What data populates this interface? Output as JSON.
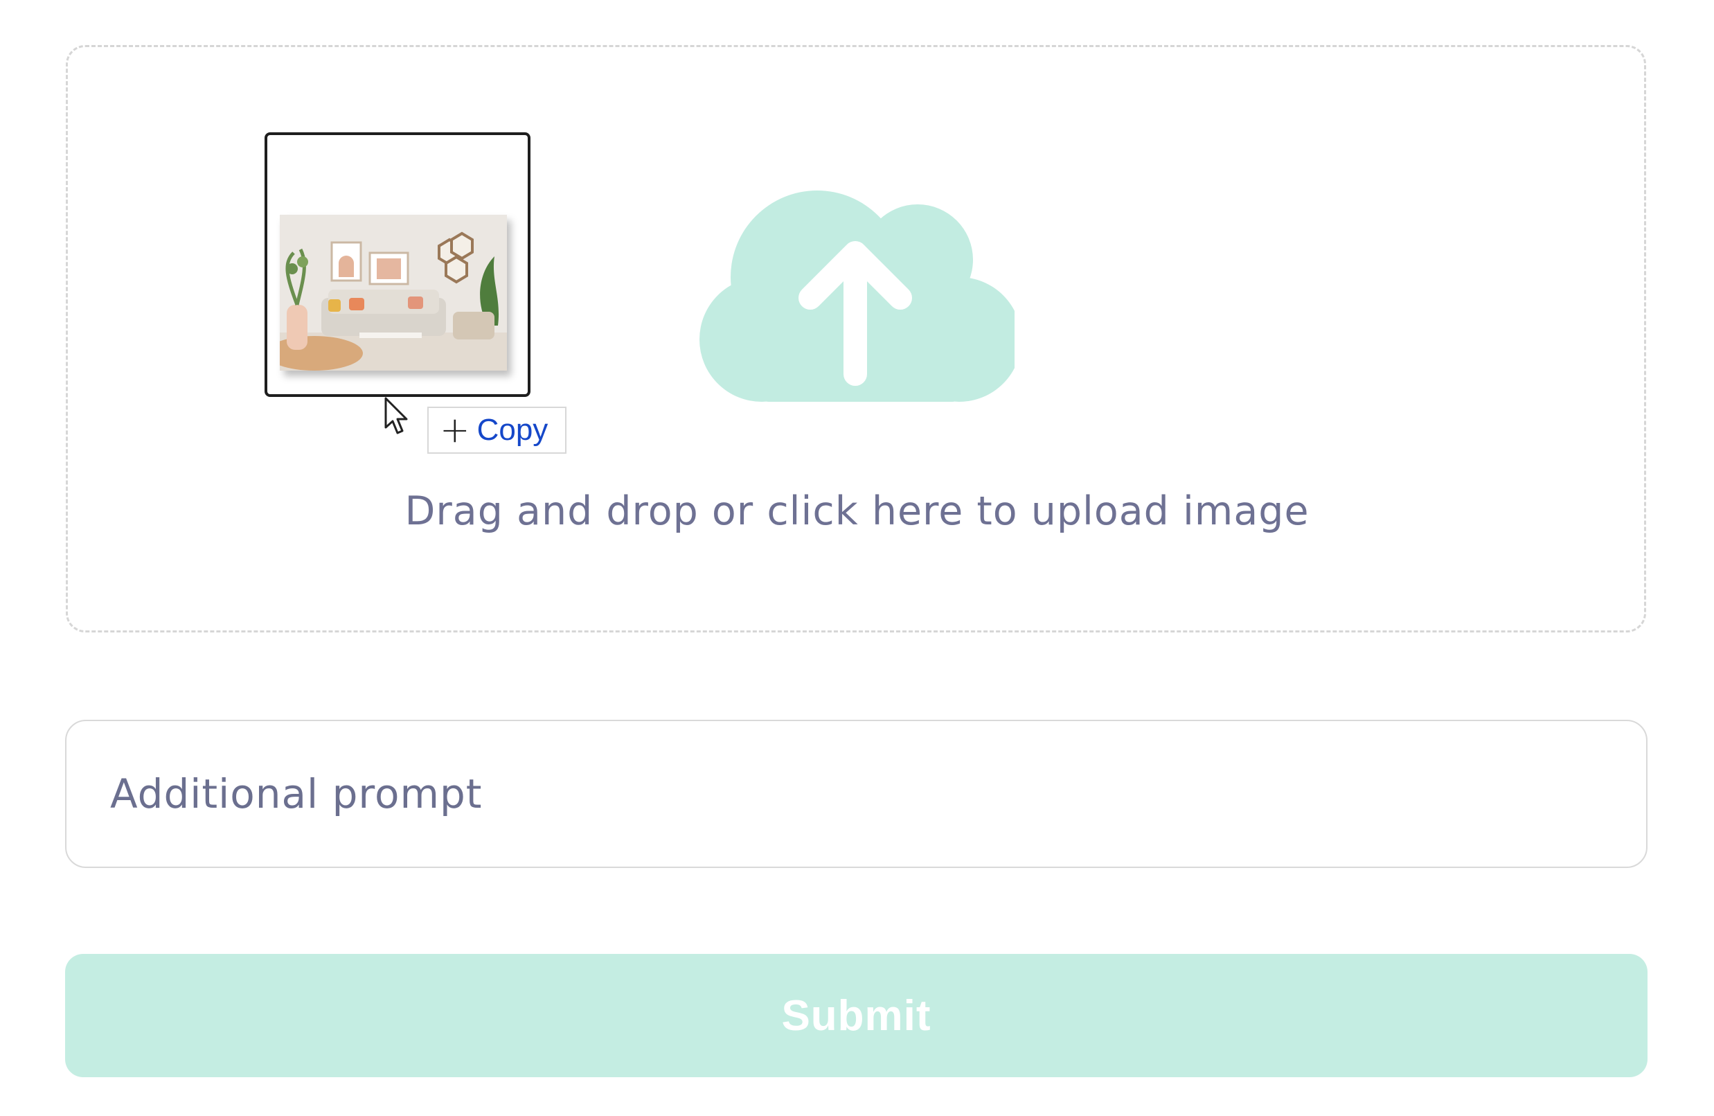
{
  "upload": {
    "instruction": "Drag and drop or click here to upload image",
    "icon": "cloud-upload-icon"
  },
  "drag_preview": {
    "copy_label": "Copy",
    "copy_symbol": "+"
  },
  "prompt": {
    "placeholder": "Additional prompt",
    "value": ""
  },
  "submit": {
    "label": "Submit"
  },
  "colors": {
    "accent": "#c4ede2",
    "cloud": "#c2ece1",
    "text_muted": "#6e7193",
    "copy_text": "#1547c9"
  }
}
